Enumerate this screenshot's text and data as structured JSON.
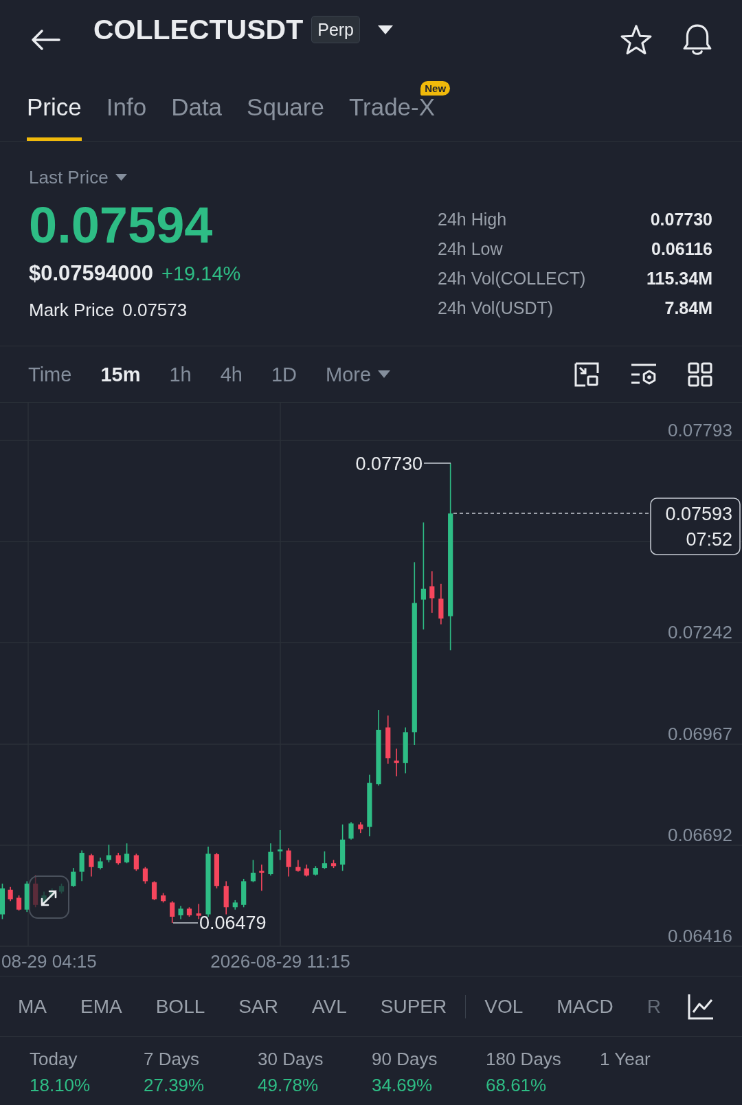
{
  "header": {
    "symbol": "COLLECTUSDT",
    "badge": "Perp"
  },
  "tabs": [
    {
      "label": "Price",
      "selected": true
    },
    {
      "label": "Info",
      "selected": false
    },
    {
      "label": "Data",
      "selected": false
    },
    {
      "label": "Square",
      "selected": false
    },
    {
      "label": "Trade-X",
      "selected": false,
      "badge": "New"
    }
  ],
  "price": {
    "selector": "Last Price",
    "last": "0.07594",
    "rising": true,
    "usd": "$0.07594000",
    "change": "+19.14%",
    "mark_label": "Mark Price",
    "mark_value": "0.07573"
  },
  "stats": [
    {
      "label": "24h High",
      "value": "0.07730"
    },
    {
      "label": "24h Low",
      "value": "0.06116"
    },
    {
      "label": "24h Vol(COLLECT)",
      "value": "115.34M"
    },
    {
      "label": "24h Vol(USDT)",
      "value": "7.84M"
    }
  ],
  "intervals": [
    {
      "label": "Time",
      "kind": "option",
      "selected": false
    },
    {
      "label": "15m",
      "kind": "option",
      "selected": true
    },
    {
      "label": "1h",
      "kind": "option",
      "selected": false
    },
    {
      "label": "4h",
      "kind": "option",
      "selected": false
    },
    {
      "label": "1D",
      "kind": "option",
      "selected": false
    },
    {
      "label": "More",
      "kind": "dropdown",
      "selected": false
    }
  ],
  "chart": {
    "y_axis": [
      "0.07793",
      "0.07242",
      "0.06967",
      "0.06692",
      "0.06416"
    ],
    "x_axis": [
      "08-29 04:15",
      "2026-08-29 11:15"
    ],
    "high_label": "0.07730",
    "low_label": "0.06479",
    "price_tag": {
      "price": "0.07593",
      "countdown": "07:52"
    }
  },
  "indicators": {
    "main": [
      "MA",
      "EMA",
      "BOLL",
      "SAR",
      "AVL",
      "SUPER"
    ],
    "sub": [
      "VOL",
      "MACD"
    ],
    "clipped": "R"
  },
  "performance": [
    {
      "period": "Today",
      "change": "18.10%",
      "rising": true
    },
    {
      "period": "7 Days",
      "change": "27.39%",
      "rising": true
    },
    {
      "period": "30 Days",
      "change": "49.78%",
      "rising": true
    },
    {
      "period": "90 Days",
      "change": "34.69%",
      "rising": true
    },
    {
      "period": "180 Days",
      "change": "68.61%",
      "rising": true
    },
    {
      "period": "1 Year"
    }
  ]
}
